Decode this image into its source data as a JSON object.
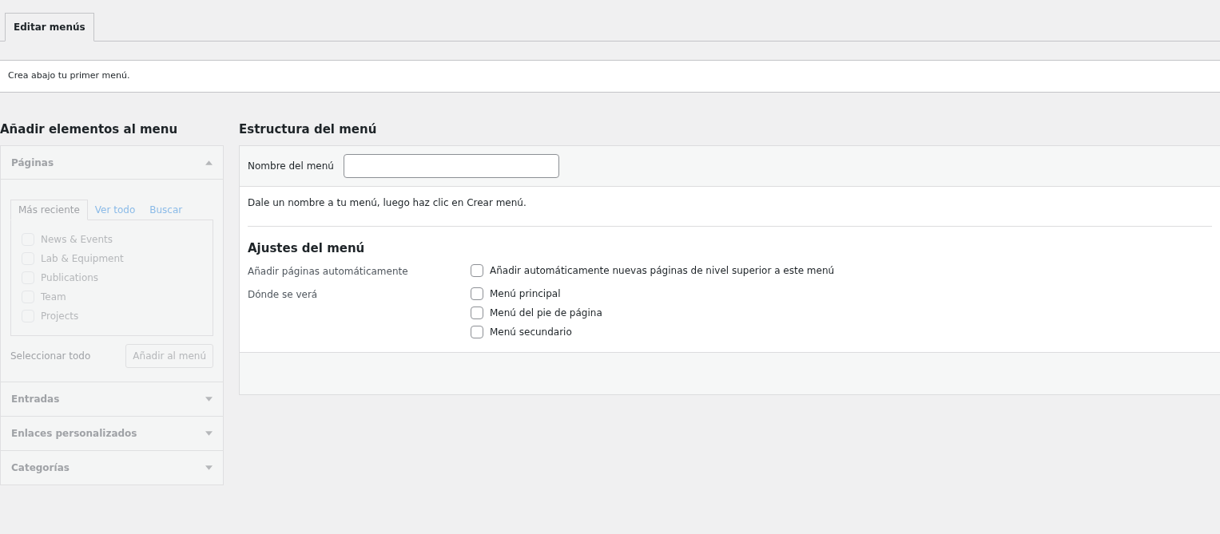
{
  "nav_tabs": [
    {
      "label": "Editar menús",
      "selected": true
    }
  ],
  "notice": "Crea abajo tu primer menú.",
  "add_items": {
    "title": "Añadir elementos al menu",
    "disabled": true,
    "sections": [
      {
        "title": "Páginas",
        "expanded": true,
        "tabs": [
          {
            "label": "Más reciente",
            "selected": true
          },
          {
            "label": "Ver todo",
            "selected": false
          },
          {
            "label": "Buscar",
            "selected": false
          }
        ],
        "items": [
          {
            "label": "News & Events",
            "checked": false
          },
          {
            "label": "Lab & Equipment",
            "checked": false
          },
          {
            "label": "Publications",
            "checked": false
          },
          {
            "label": "Team",
            "checked": false
          },
          {
            "label": "Projects",
            "checked": false
          }
        ],
        "select_all": "Seleccionar todo",
        "add_button": "Añadir al menú"
      },
      {
        "title": "Entradas",
        "expanded": false
      },
      {
        "title": "Enlaces personalizados",
        "expanded": false
      },
      {
        "title": "Categorías",
        "expanded": false
      }
    ]
  },
  "structure": {
    "title": "Estructura del menú",
    "name_label": "Nombre del menú",
    "hint": "Dale un nombre a tu menú, luego haz clic en Crear menú.",
    "settings_title": "Ajustes del menú",
    "settings": [
      {
        "label": "Añadir páginas automáticamente",
        "options": [
          {
            "label": "Añadir automáticamente nuevas páginas de nivel superior a este menú",
            "checked": false
          }
        ]
      },
      {
        "label": "Dónde se verá",
        "options": [
          {
            "label": "Menú principal",
            "checked": false
          },
          {
            "label": "Menú del pie de página",
            "checked": false
          },
          {
            "label": "Menú secundario",
            "checked": false
          }
        ]
      }
    ]
  }
}
